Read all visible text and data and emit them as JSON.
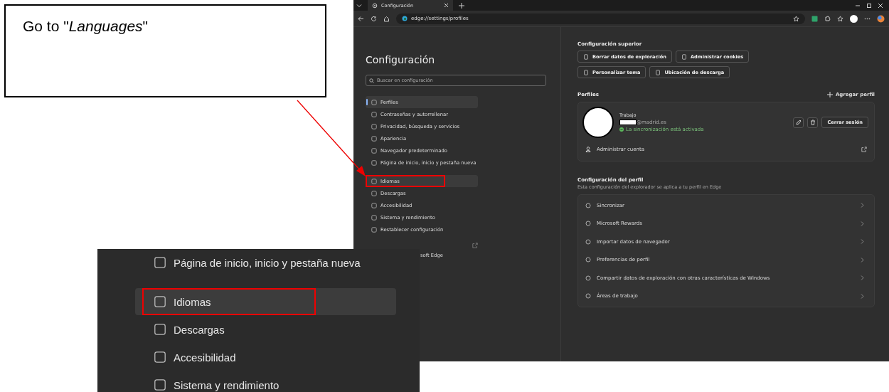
{
  "callout": {
    "text": "Go to \"*Languages*\""
  },
  "browser": {
    "tab_title": "Configuración",
    "url": "edge://settings/profiles",
    "sidebar": {
      "title": "Configuración",
      "search_placeholder": "Buscar en configuración",
      "items": [
        {
          "label": "Perfiles",
          "selected": true,
          "highlighted": false
        },
        {
          "label": "Contraseñas y autorrellenar",
          "selected": false,
          "highlighted": false
        },
        {
          "label": "Privacidad, búsqueda y servicios",
          "selected": false,
          "highlighted": false
        },
        {
          "label": "Apariencia",
          "selected": false,
          "highlighted": false
        },
        {
          "label": "Navegador predeterminado",
          "selected": false,
          "highlighted": false
        },
        {
          "label": "Página de inicio, inicio y pestaña nueva",
          "selected": false,
          "highlighted": false
        },
        {
          "label": "Idiomas",
          "selected": false,
          "highlighted": true
        },
        {
          "label": "Descargas",
          "selected": false,
          "highlighted": false
        },
        {
          "label": "Accesibilidad",
          "selected": false,
          "highlighted": false
        },
        {
          "label": "Sistema y rendimiento",
          "selected": false,
          "highlighted": false
        },
        {
          "label": "Restablecer configuración",
          "selected": false,
          "highlighted": false
        }
      ],
      "partial_item": "soft Edge"
    },
    "top_settings": {
      "title": "Configuración superior",
      "buttons": [
        "Borrar datos de exploración",
        "Administrar cookies",
        "Personalizar tema",
        "Ubicación de descarga"
      ]
    },
    "profiles": {
      "title": "Perfiles",
      "add_label": "Agregar perfil",
      "name": "Trabajo",
      "email": "@madrid.es",
      "sync_status": "La sincronización está activada",
      "sign_out": "Cerrar sesión",
      "manage_account": "Administrar cuenta"
    },
    "profile_settings": {
      "title": "Configuración del perfil",
      "subtitle": "Esta configuración del explorador se aplica a tu perfil en Edge",
      "items": [
        "Sincronizar",
        "Microsoft Rewards",
        "Importar datos de navegador",
        "Preferencias de perfil",
        "Compartir datos de exploración con otras características de Windows",
        "Áreas de trabajo"
      ]
    }
  },
  "inset": {
    "items": [
      {
        "label": "Página de inicio, inicio y pestaña nueva",
        "highlighted": false
      },
      {
        "label": "Idiomas",
        "highlighted": true
      },
      {
        "label": "Descargas",
        "highlighted": false
      },
      {
        "label": "Accesibilidad",
        "highlighted": false
      },
      {
        "label": "Sistema y rendimiento",
        "highlighted": false
      }
    ]
  }
}
